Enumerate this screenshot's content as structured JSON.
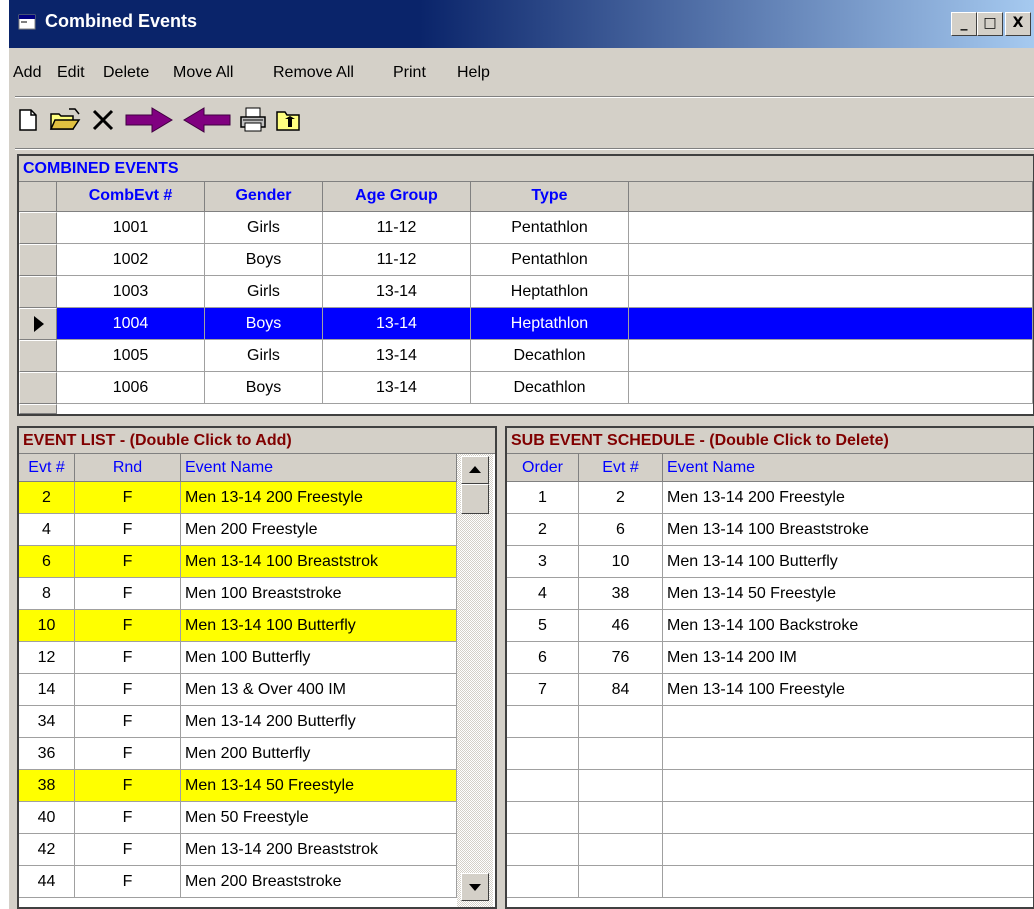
{
  "window": {
    "title": "Combined Events",
    "minimize": "_",
    "maximize": "□",
    "close": "X"
  },
  "menu": [
    "Add",
    "Edit",
    "Delete",
    "Move All",
    "Remove All",
    "Print",
    "Help"
  ],
  "toolbar": [
    "new-icon",
    "open-folder-icon",
    "delete-x-icon",
    "arrow-right-icon",
    "arrow-left-icon",
    "printer-icon",
    "folder-up-icon"
  ],
  "combined": {
    "caption": "COMBINED EVENTS",
    "headers": [
      "CombEvt #",
      "Gender",
      "Age Group",
      "Type"
    ],
    "rows": [
      [
        "1001",
        "Girls",
        "11-12",
        "Pentathlon"
      ],
      [
        "1002",
        "Boys",
        "11-12",
        "Pentathlon"
      ],
      [
        "1003",
        "Girls",
        "13-14",
        "Heptathlon"
      ],
      [
        "1004",
        "Boys",
        "13-14",
        "Heptathlon"
      ],
      [
        "1005",
        "Girls",
        "13-14",
        "Decathlon"
      ],
      [
        "1006",
        "Boys",
        "13-14",
        "Decathlon"
      ]
    ],
    "selected_index": 3
  },
  "event_list": {
    "caption": "EVENT LIST - (Double Click to Add)",
    "headers": [
      "Evt #",
      "Rnd",
      "Event Name"
    ],
    "rows": [
      [
        "2",
        "F",
        "Men 13-14 200 Freestyle",
        true
      ],
      [
        "4",
        "F",
        "Men 200 Freestyle",
        false
      ],
      [
        "6",
        "F",
        "Men 13-14 100 Breaststrok",
        true
      ],
      [
        "8",
        "F",
        "Men 100 Breaststroke",
        false
      ],
      [
        "10",
        "F",
        "Men 13-14 100 Butterfly",
        true
      ],
      [
        "12",
        "F",
        "Men 100 Butterfly",
        false
      ],
      [
        "14",
        "F",
        "Men 13 & Over 400 IM",
        false
      ],
      [
        "34",
        "F",
        "Men 13-14 200 Butterfly",
        false
      ],
      [
        "36",
        "F",
        "Men 200 Butterfly",
        false
      ],
      [
        "38",
        "F",
        "Men 13-14 50 Freestyle",
        true
      ],
      [
        "40",
        "F",
        "Men 50 Freestyle",
        false
      ],
      [
        "42",
        "F",
        "Men 13-14 200 Breaststrok",
        false
      ],
      [
        "44",
        "F",
        "Men 200 Breaststroke",
        false
      ]
    ]
  },
  "schedule": {
    "caption": "SUB EVENT SCHEDULE - (Double Click to Delete)",
    "headers": [
      "Order",
      "Evt #",
      "Event Name"
    ],
    "rows": [
      [
        "1",
        "2",
        "Men 13-14 200 Freestyle"
      ],
      [
        "2",
        "6",
        "Men 13-14 100 Breaststroke"
      ],
      [
        "3",
        "10",
        "Men 13-14 100 Butterfly"
      ],
      [
        "4",
        "38",
        "Men 13-14 50 Freestyle"
      ],
      [
        "5",
        "46",
        "Men 13-14 100 Backstroke"
      ],
      [
        "6",
        "76",
        "Men 13-14 200 IM"
      ],
      [
        "7",
        "84",
        "Men 13-14 100 Freestyle"
      ]
    ]
  },
  "colors": {
    "caption_blue": "#0000ff",
    "caption_red": "#800000",
    "selection": "#0000ff",
    "highlight": "#ffff00"
  }
}
